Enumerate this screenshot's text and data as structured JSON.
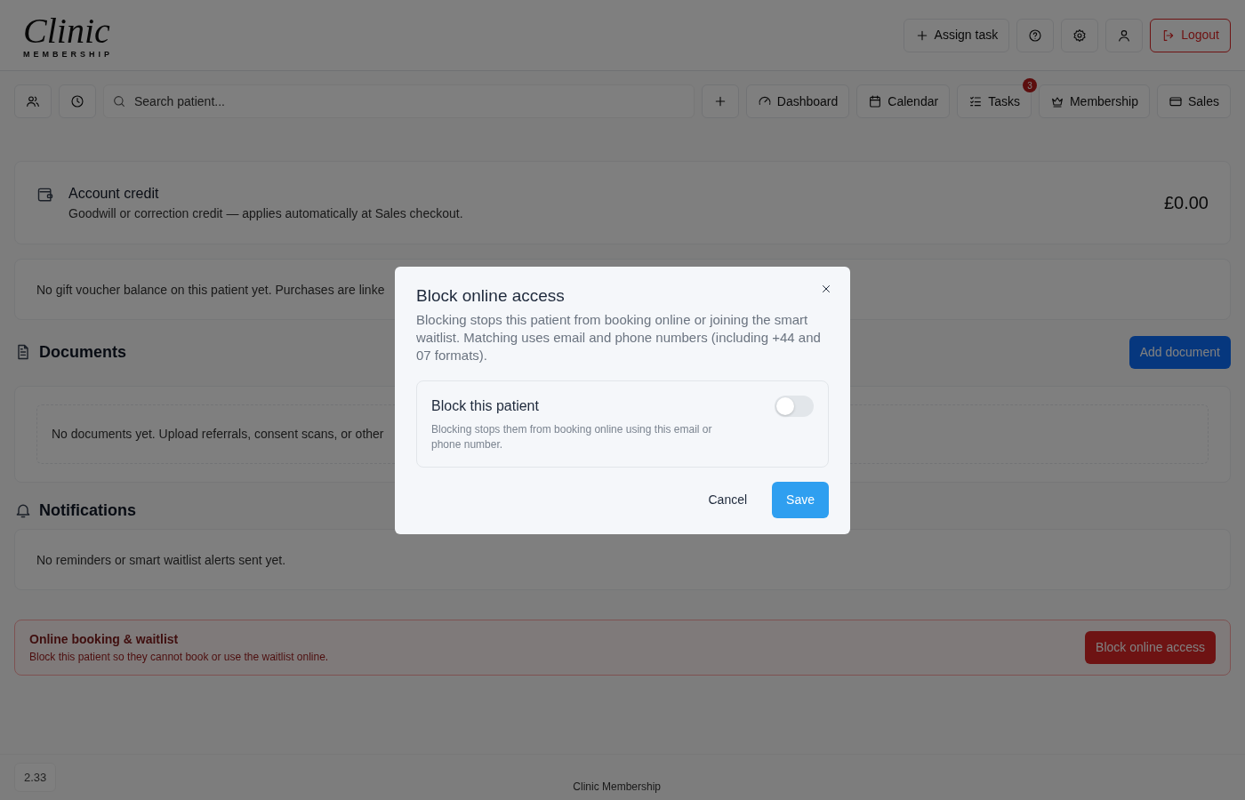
{
  "header": {
    "logo": {
      "script": "Clinic",
      "tagline": "MEMBERSHIP"
    },
    "actions": [
      {
        "kind": "text",
        "label": "Assign task"
      },
      {
        "kind": "help"
      },
      {
        "kind": "settings"
      },
      {
        "kind": "user"
      },
      {
        "kind": "danger",
        "label": "Logout"
      }
    ]
  },
  "toolbar": {
    "search": {
      "placeholder": "Search patient..."
    },
    "nav": [
      {
        "kind": "add"
      },
      {
        "kind": "tab",
        "label": "Dashboard"
      },
      {
        "kind": "tab",
        "label": "Calendar"
      },
      {
        "kind": "tab",
        "label": "Tasks",
        "badge": "3"
      },
      {
        "kind": "tab",
        "label": "Membership"
      },
      {
        "kind": "tab",
        "label": "Sales"
      }
    ]
  },
  "credit": {
    "title": "Account credit",
    "subtitle": "Goodwill or correction credit — applies automatically at Sales checkout.",
    "amount": "£0.00"
  },
  "voucher_note": "No gift voucher balance on this patient yet. Purchases are linke",
  "documents": {
    "heading": "Documents",
    "button": "Add document",
    "empty_text": "No documents yet. Upload referrals, consent scans, or other"
  },
  "notifications": {
    "heading": "Notifications",
    "empty_text": "No reminders or smart waitlist alerts sent yet."
  },
  "online_booking": {
    "title": "Online booking & waitlist",
    "subtitle": "Block this patient so they cannot book or use the waitlist online.",
    "button": "Block online access"
  },
  "footer": {
    "version": "2.33",
    "text": "Clinic Membership"
  },
  "modal": {
    "title": "Block online access",
    "description": "Blocking stops this patient from booking online or joining the smart waitlist. Matching uses email and phone numbers (including +44 and 07 formats).",
    "option": {
      "title": "Block this patient",
      "description": "Blocking stops them from booking online using this email or phone number.",
      "on": false
    },
    "buttons": [
      {
        "kind": "cancel",
        "label": "Cancel"
      },
      {
        "kind": "primary",
        "label": "Save"
      }
    ]
  }
}
